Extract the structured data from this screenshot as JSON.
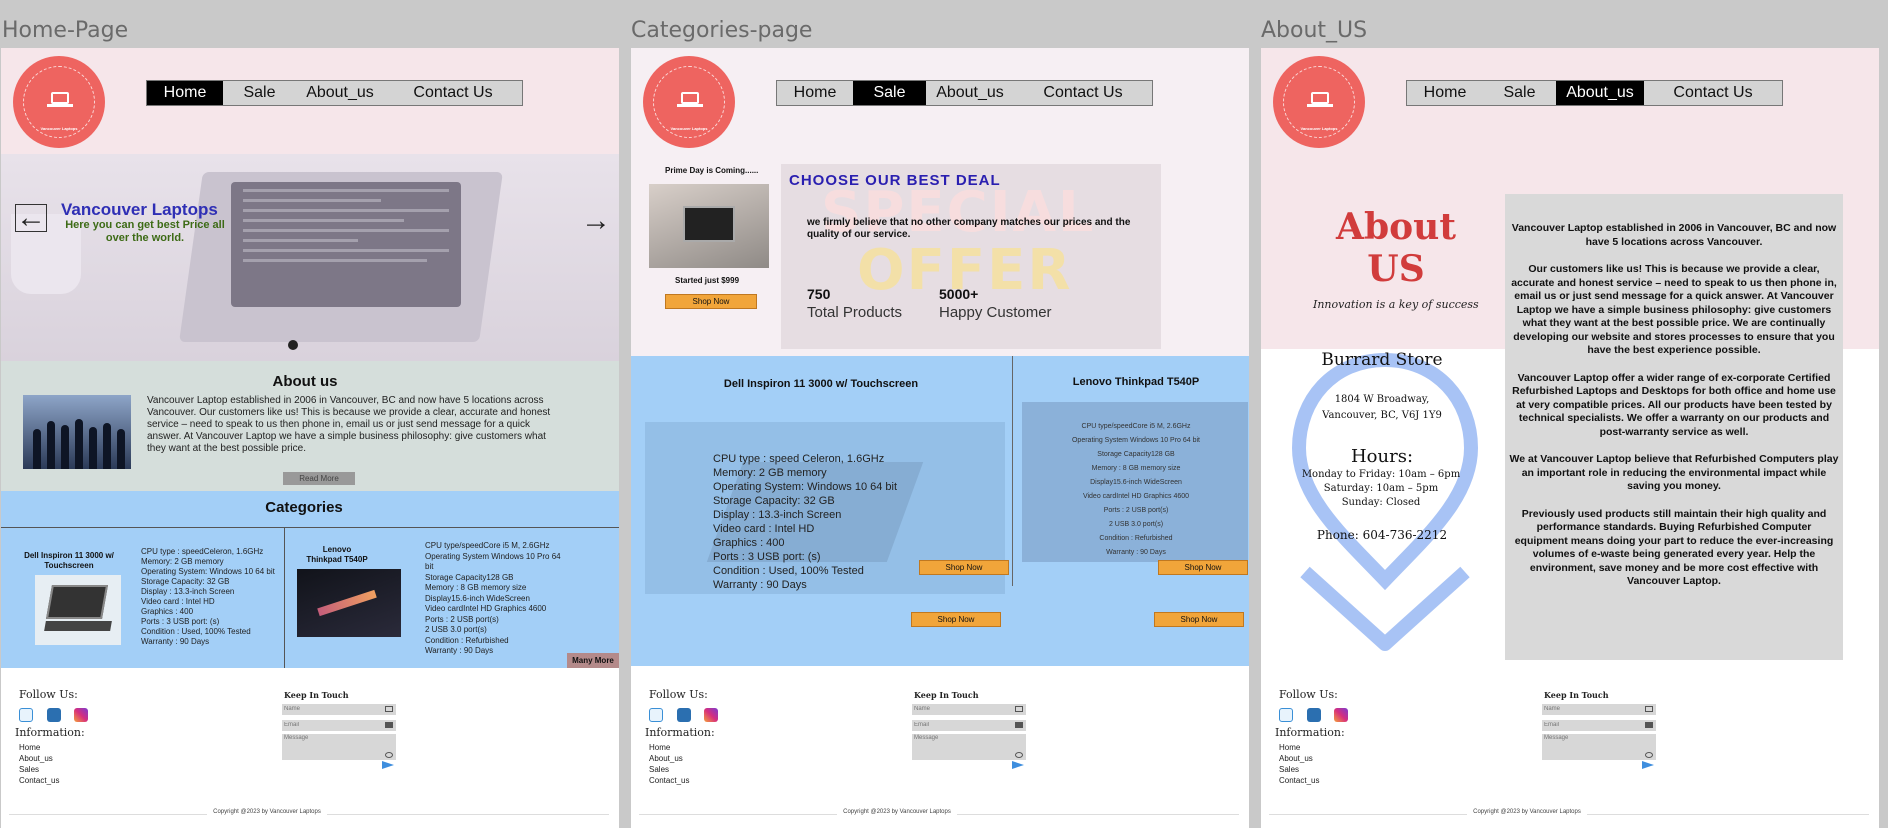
{
  "frames": {
    "home": "Home-Page",
    "categories": "Categories-page",
    "about": "About_US"
  },
  "nav": [
    "Home",
    "Sale",
    "About_us",
    "Contact Us"
  ],
  "logo": {
    "text": "Vancouver Laptops"
  },
  "home": {
    "hero": {
      "title": "Vancouver Laptops",
      "subtitle": "Here you can get best Price all over the world."
    },
    "about": {
      "title": "About us",
      "text": "Vancouver Laptop established in 2006 in Vancouver, BC and now have 5 locations across Vancouver. Our customers like us! This is because we provide a clear, accurate and honest service – need to speak to us then phone in, email us or just send message for a quick answer. At Vancouver Laptop we have a simple business philosophy: give customers what they want at the best possible price.",
      "read_more": "Read More"
    },
    "categories": {
      "title": "Categories",
      "more": "Many More",
      "items": [
        {
          "name": "Dell Inspiron 11 3000 w/ Touchscreen",
          "specs": "CPU type : speedCeleron, 1.6GHz\nMemory: 2 GB memory\nOperating System: Windows 10 64 bit\nStorage Capacity: 32 GB\nDisplay : 13.3-inch Screen\nVideo card : Intel HD\nGraphics : 400\nPorts : 3 USB port: (s)\nCondition : Used, 100% Tested\nWarranty : 90 Days"
        },
        {
          "name": "Lenovo Thinkpad T540P",
          "specs": "CPU type/speedCore i5 M, 2.6GHz\nOperating System Windows 10 Pro 64 bit\nStorage Capacity128 GB\nMemory : 8 GB memory size\nDisplay15.6-inch WideScreen\nVideo cardIntel HD Graphics 4600\nPorts : 2 USB port(s)\n            2 USB 3.0 port(s)\nCondition : Refurbished\nWarranty : 90 Days"
        }
      ]
    }
  },
  "categories": {
    "promo": {
      "prime": "Prime Day is Coming......",
      "started": "Started just $999",
      "shop": "Shop Now"
    },
    "deal": {
      "heading": "CHOOSE OUR BEST DEAL",
      "special": "SPECIAL",
      "offer": "OFFER",
      "text": "we firmly believe that no other company matches our prices and the quality of our service.",
      "stats": [
        {
          "value": "750",
          "label": "Total Products"
        },
        {
          "value": "5000+",
          "label": "Happy Customer"
        }
      ]
    },
    "products": [
      {
        "name": "Dell Inspiron 11 3000 w/ Touchscreen",
        "specs": "CPU type : speed Celeron, 1.6GHz\nMemory: 2 GB memory\nOperating System: Windows 10 64 bit\nStorage Capacity: 32 GB\nDisplay : 13.3-inch Screen\nVideo card : Intel HD\nGraphics : 400\nPorts : 3 USB port: (s)\nCondition : Used, 100% Tested\nWarranty : 90 Days"
      },
      {
        "name": "Lenovo Thinkpad T540P",
        "specs": "CPU type/speedCore i5 M, 2.6GHz\nOperating System Windows 10 Pro 64 bit\nStorage Capacity128 GB\nMemory : 8 GB memory size\nDisplay15.6-inch WideScreen\nVideo cardIntel HD Graphics 4600\nPorts : 2 USB port(s)\n            2 USB 3.0 port(s)\nCondition : Refurbished\nWarranty : 90 Days"
      }
    ],
    "shop_now": "Shop Now"
  },
  "about": {
    "big_title_1": "About",
    "big_title_2": "US",
    "tagline": "Innovation is a key of success",
    "store": {
      "name": "Burrard Store",
      "address_1": "1804 W Broadway,",
      "address_2": "Vancouver, BC, V6J 1Y9",
      "hours_title": "Hours:",
      "hours_1": "Monday to Friday: 10am – 6pm",
      "hours_2": "Saturday: 10am – 5pm",
      "hours_3": "Sunday: Closed",
      "phone": "Phone: 604-736-2212"
    },
    "paragraphs": [
      "Vancouver Laptop established in 2006 in Vancouver, BC and now have 5 locations across Vancouver.",
      "Our customers like us! This is because we provide a clear, accurate and honest service – need to speak to us then phone in, email us or just send message for a quick answer. At Vancouver Laptop we have a simple business philosophy: give customers what they want at the best possible price. We are continually developing our website and stores processes to ensure that you have the best experience possible.",
      "Vancouver Laptop offer a wider range of ex-corporate Certified Refurbished Laptops and Desktops for both office and home use at very compatible prices. All our products have been tested by technical specialists. We offer a warranty on our products and post-warranty service as well.",
      "We at Vancouver Laptop believe that Refurbished Computers play an important role in reducing the environmental impact while saving you money.",
      "Previously used products still maintain their high quality and performance standards. Buying Refurbished Computer equipment means doing your part to reduce the ever-increasing volumes of e-waste being generated every year. Help the environment, save money and be more cost effective with Vancouver Laptop."
    ]
  },
  "footer": {
    "follow": "Follow Us:",
    "information": "Information:",
    "links": [
      "Home",
      "About_us",
      "Sales",
      "Contact_us"
    ],
    "keep": "Keep In Touch",
    "name_ph": "Name",
    "email_ph": "Email",
    "message_ph": "Message",
    "copyright": "Copyright @2023 by Vancouver Laptops"
  },
  "colors": {
    "header_pink": "#f6e6ea",
    "logo_red": "#ee6460",
    "category_blue": "#a3cff7",
    "shop_orange": "#f1a53a",
    "about_red": "#d13c3c"
  }
}
